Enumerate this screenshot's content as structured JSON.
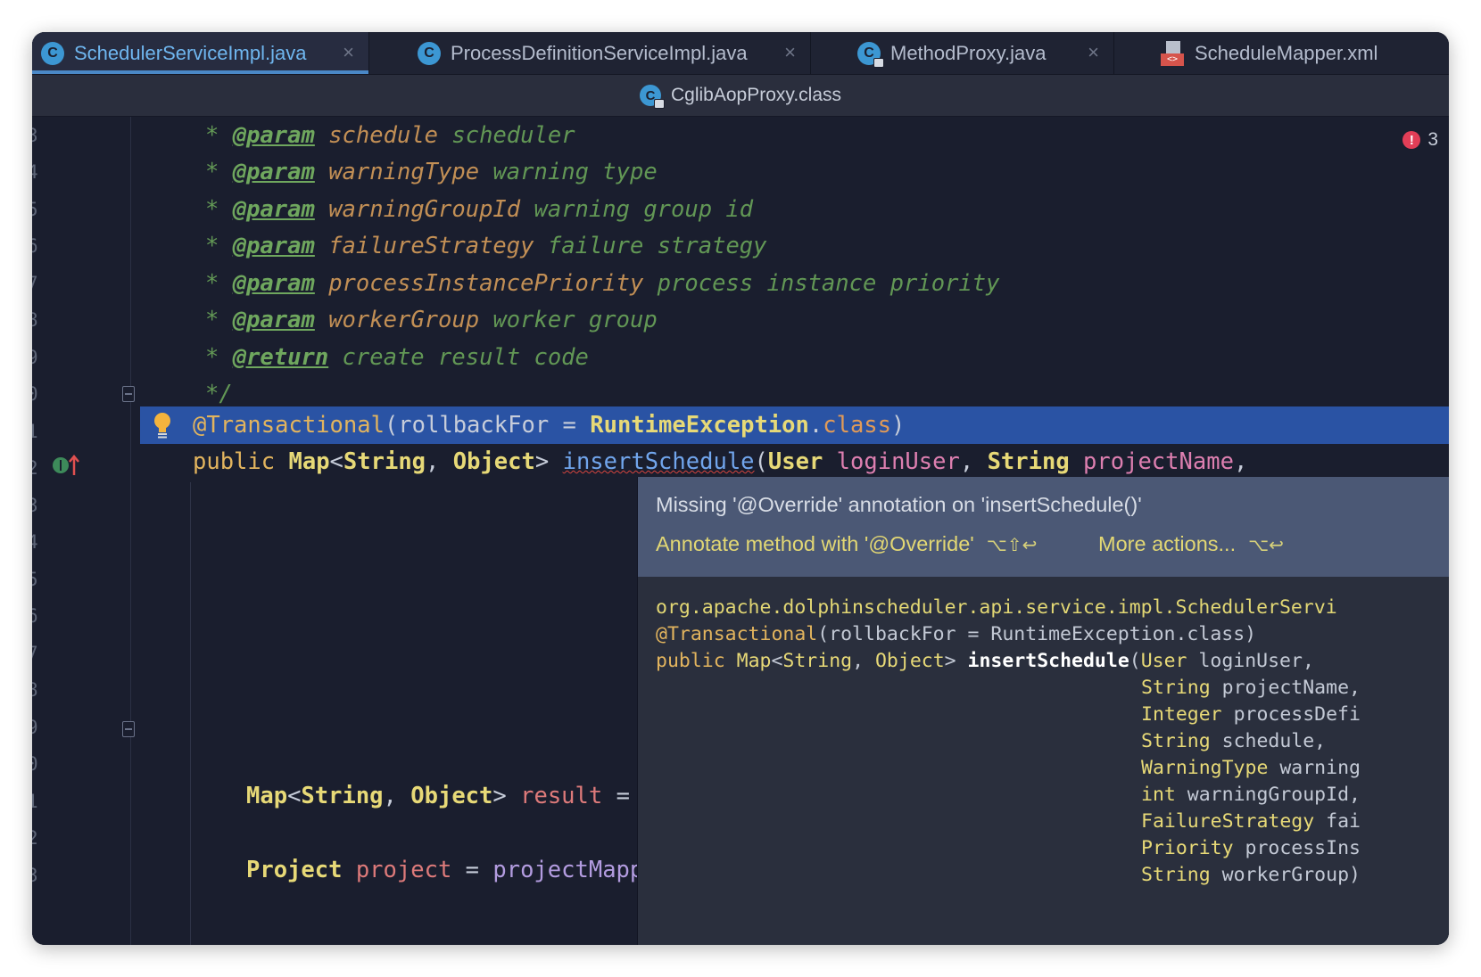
{
  "tabs": [
    {
      "label": "SchedulerServiceImpl.java",
      "active": true
    },
    {
      "label": "ProcessDefinitionServiceImpl.java",
      "active": false
    },
    {
      "label": "MethodProxy.java",
      "active": false
    },
    {
      "label": "ScheduleMapper.xml",
      "active": false
    }
  ],
  "tab_close_glyph": "×",
  "class_icon_letter": "C",
  "xml_icon_glyph": "<>",
  "secondary_tab": {
    "label": "CglibAopProxy.class"
  },
  "inspection": {
    "error_count": "3",
    "error_glyph": "!"
  },
  "line_numbers": [
    "3",
    "4",
    "5",
    "6",
    "7",
    "8",
    "9",
    "0",
    "1",
    "2",
    "3",
    "4",
    "5",
    "6",
    "7",
    "8",
    "9",
    "0",
    "1",
    "2",
    "3"
  ],
  "javadoc": [
    {
      "tag": "@param",
      "name": "schedule",
      "desc": "scheduler"
    },
    {
      "tag": "@param",
      "name": "warningType",
      "desc": "warning type"
    },
    {
      "tag": "@param",
      "name": "warningGroupId",
      "desc": "warning group id"
    },
    {
      "tag": "@param",
      "name": "failureStrategy",
      "desc": "failure strategy"
    },
    {
      "tag": "@param",
      "name": "processInstancePriority",
      "desc": "process instance priority"
    },
    {
      "tag": "@param",
      "name": "workerGroup",
      "desc": "worker group"
    },
    {
      "tag": "@return",
      "desc": "create result code"
    }
  ],
  "code": {
    "star": "*",
    "doc_end": "*/",
    "annotation": {
      "name": "@Transactional",
      "open": "(",
      "attr": "rollbackFor",
      "eq": " = ",
      "type": "RuntimeException",
      "dot": ".",
      "cls": "class",
      "close": ")"
    },
    "signature": {
      "kw": "public",
      "type": "Map",
      "lt": "<",
      "t1": "String",
      "comma": ",",
      "t2": "Object",
      "gt": ">",
      "method": "insertSchedule",
      "open": "(",
      "p1_type": "User",
      "p1": "loginUser",
      "p2_type": "String",
      "p2": "projectName"
    },
    "result_line": {
      "type": "Map",
      "lt": "<",
      "t1": "String",
      "comma": ",",
      "t2": "Object",
      "gt": ">",
      "var": "result",
      "eq": "="
    },
    "project_line": {
      "type": "Project",
      "var": "project",
      "eq": "=",
      "rhs": "projectMapp"
    }
  },
  "popup": {
    "message": "Missing '@Override' annotation on 'insertSchedule()'",
    "fix_action": "Annotate method with '@Override'",
    "fix_shortcut": "⌥⇧↩",
    "more_actions": "More actions...",
    "more_shortcut": "⌥↩",
    "doc": {
      "package": "org.apache.dolphinscheduler.api.service.impl.SchedulerServi",
      "annotation": "@Transactional",
      "annotation_args": "(rollbackFor = RuntimeException.class)",
      "sig_kw": "public",
      "sig_type": "Map",
      "sig_generic_open": "<",
      "sig_t1": "String",
      "sig_comma": ", ",
      "sig_t2": "Object",
      "sig_generic_close": "> ",
      "sig_method": "insertSchedule",
      "sig_open": "(",
      "params": [
        {
          "type": "User",
          "name": "loginUser,"
        },
        {
          "type": "String",
          "name": "projectName,"
        },
        {
          "type": "Integer",
          "name": "processDefi"
        },
        {
          "type": "String",
          "name": "schedule,"
        },
        {
          "type": "WarningType",
          "name": "warning"
        },
        {
          "type": "int",
          "name": "warningGroupId,"
        },
        {
          "type": "FailureStrategy",
          "name": "fai"
        },
        {
          "type": "Priority",
          "name": "processIns"
        },
        {
          "type": "String",
          "name": "workerGroup)"
        }
      ]
    }
  },
  "colors": {
    "editor_bg": "#1a1e2e",
    "selection": "#2a53a4",
    "doc_comment": "#629755",
    "annotation": "#e2b45e",
    "popup_header": "#4b5875",
    "error": "#e23e57"
  }
}
